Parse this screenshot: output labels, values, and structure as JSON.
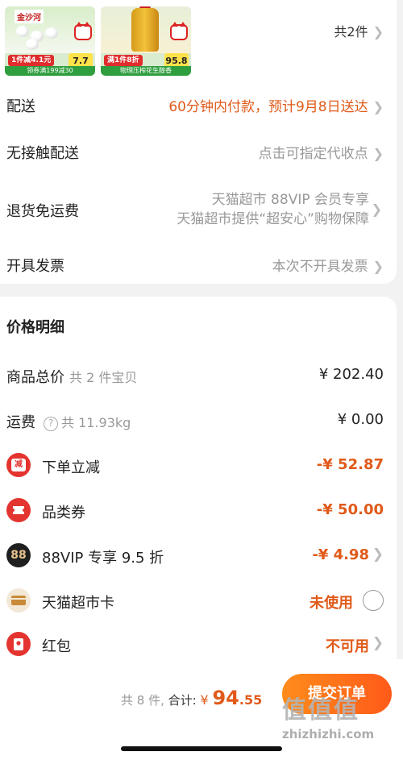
{
  "products": [
    {
      "brand": "金沙河",
      "promo": "1件减4.1元",
      "price": "7.7",
      "band": "领券满199减30"
    },
    {
      "promo": "满1件8折",
      "price": "95.8",
      "band": "物理压榨花生醇香"
    }
  ],
  "order": {
    "item_count": "共2件",
    "delivery": {
      "label": "配送",
      "value": "60分钟内付款，预计9月8日送达"
    },
    "contactless": {
      "label": "无接触配送",
      "value": "点击可指定代收点"
    },
    "returns": {
      "label": "退货免运费",
      "line1": "天猫超市 88VIP 会员专享",
      "line2": "天猫超市提供“超安心”购物保障"
    },
    "invoice": {
      "label": "开具发票",
      "value": "本次不开具发票"
    }
  },
  "price_detail": {
    "title": "价格明细",
    "goods_total": {
      "label": "商品总价",
      "sub": "共 2 件宝贝",
      "value": "¥ 202.40"
    },
    "shipping": {
      "label": "运费",
      "sub": "共 11.93kg",
      "value": "¥ 0.00"
    },
    "instant_discount": {
      "label": "下单立减",
      "icon_text": "减",
      "value": "-¥ 52.87"
    },
    "category_coupon": {
      "label": "品类券",
      "value": "-¥ 50.00"
    },
    "vip": {
      "label": "88VIP 专享 9.5 折",
      "icon_text": "88",
      "value": "-¥ 4.98"
    },
    "card": {
      "label": "天猫超市卡",
      "value": "未使用"
    },
    "red_packet": {
      "label": "红包",
      "value": "不可用"
    }
  },
  "footer": {
    "count": "共 8 件,",
    "total_label": "合计:",
    "currency": "¥",
    "total_int": "94",
    "total_dec": ".55",
    "submit": "提交订单"
  },
  "watermark": {
    "glyphs": "值值值",
    "url": "zhizhizhi.com"
  }
}
